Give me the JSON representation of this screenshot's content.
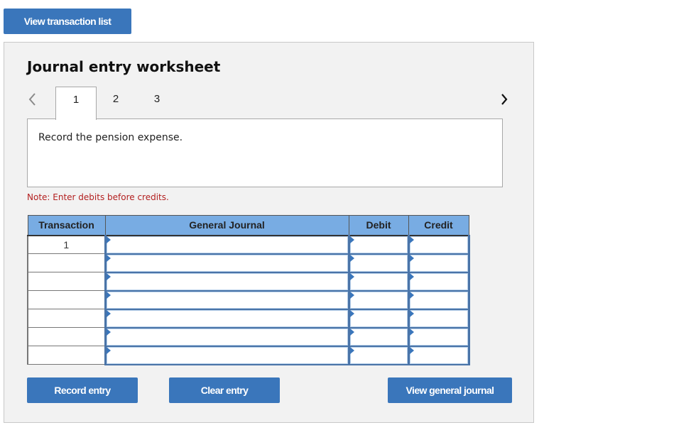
{
  "top_button": {
    "label": "View transaction list"
  },
  "worksheet": {
    "title": "Journal entry worksheet",
    "nav": {
      "prev_icon": "chevron-left-icon",
      "next_icon": "chevron-right-icon"
    },
    "tabs": [
      {
        "label": "1",
        "active": true
      },
      {
        "label": "2",
        "active": false
      },
      {
        "label": "3",
        "active": false
      }
    ],
    "instruction": "Record the pension expense.",
    "note": "Note: Enter debits before credits.",
    "note_color": "#b32020",
    "table": {
      "headers": [
        "Transaction",
        "General Journal",
        "Debit",
        "Credit"
      ],
      "rows": [
        {
          "transaction": "1",
          "account": "",
          "debit": "",
          "credit": ""
        },
        {
          "transaction": "",
          "account": "",
          "debit": "",
          "credit": ""
        },
        {
          "transaction": "",
          "account": "",
          "debit": "",
          "credit": ""
        },
        {
          "transaction": "",
          "account": "",
          "debit": "",
          "credit": ""
        },
        {
          "transaction": "",
          "account": "",
          "debit": "",
          "credit": ""
        },
        {
          "transaction": "",
          "account": "",
          "debit": "",
          "credit": ""
        },
        {
          "transaction": "",
          "account": "",
          "debit": "",
          "credit": ""
        }
      ]
    },
    "buttons": {
      "record": "Record entry",
      "clear": "Clear entry",
      "view_journal": "View general journal"
    }
  },
  "colors": {
    "button_bg": "#3a76bb",
    "header_bg": "#78ace3",
    "panel_bg": "#f2f2f2"
  }
}
